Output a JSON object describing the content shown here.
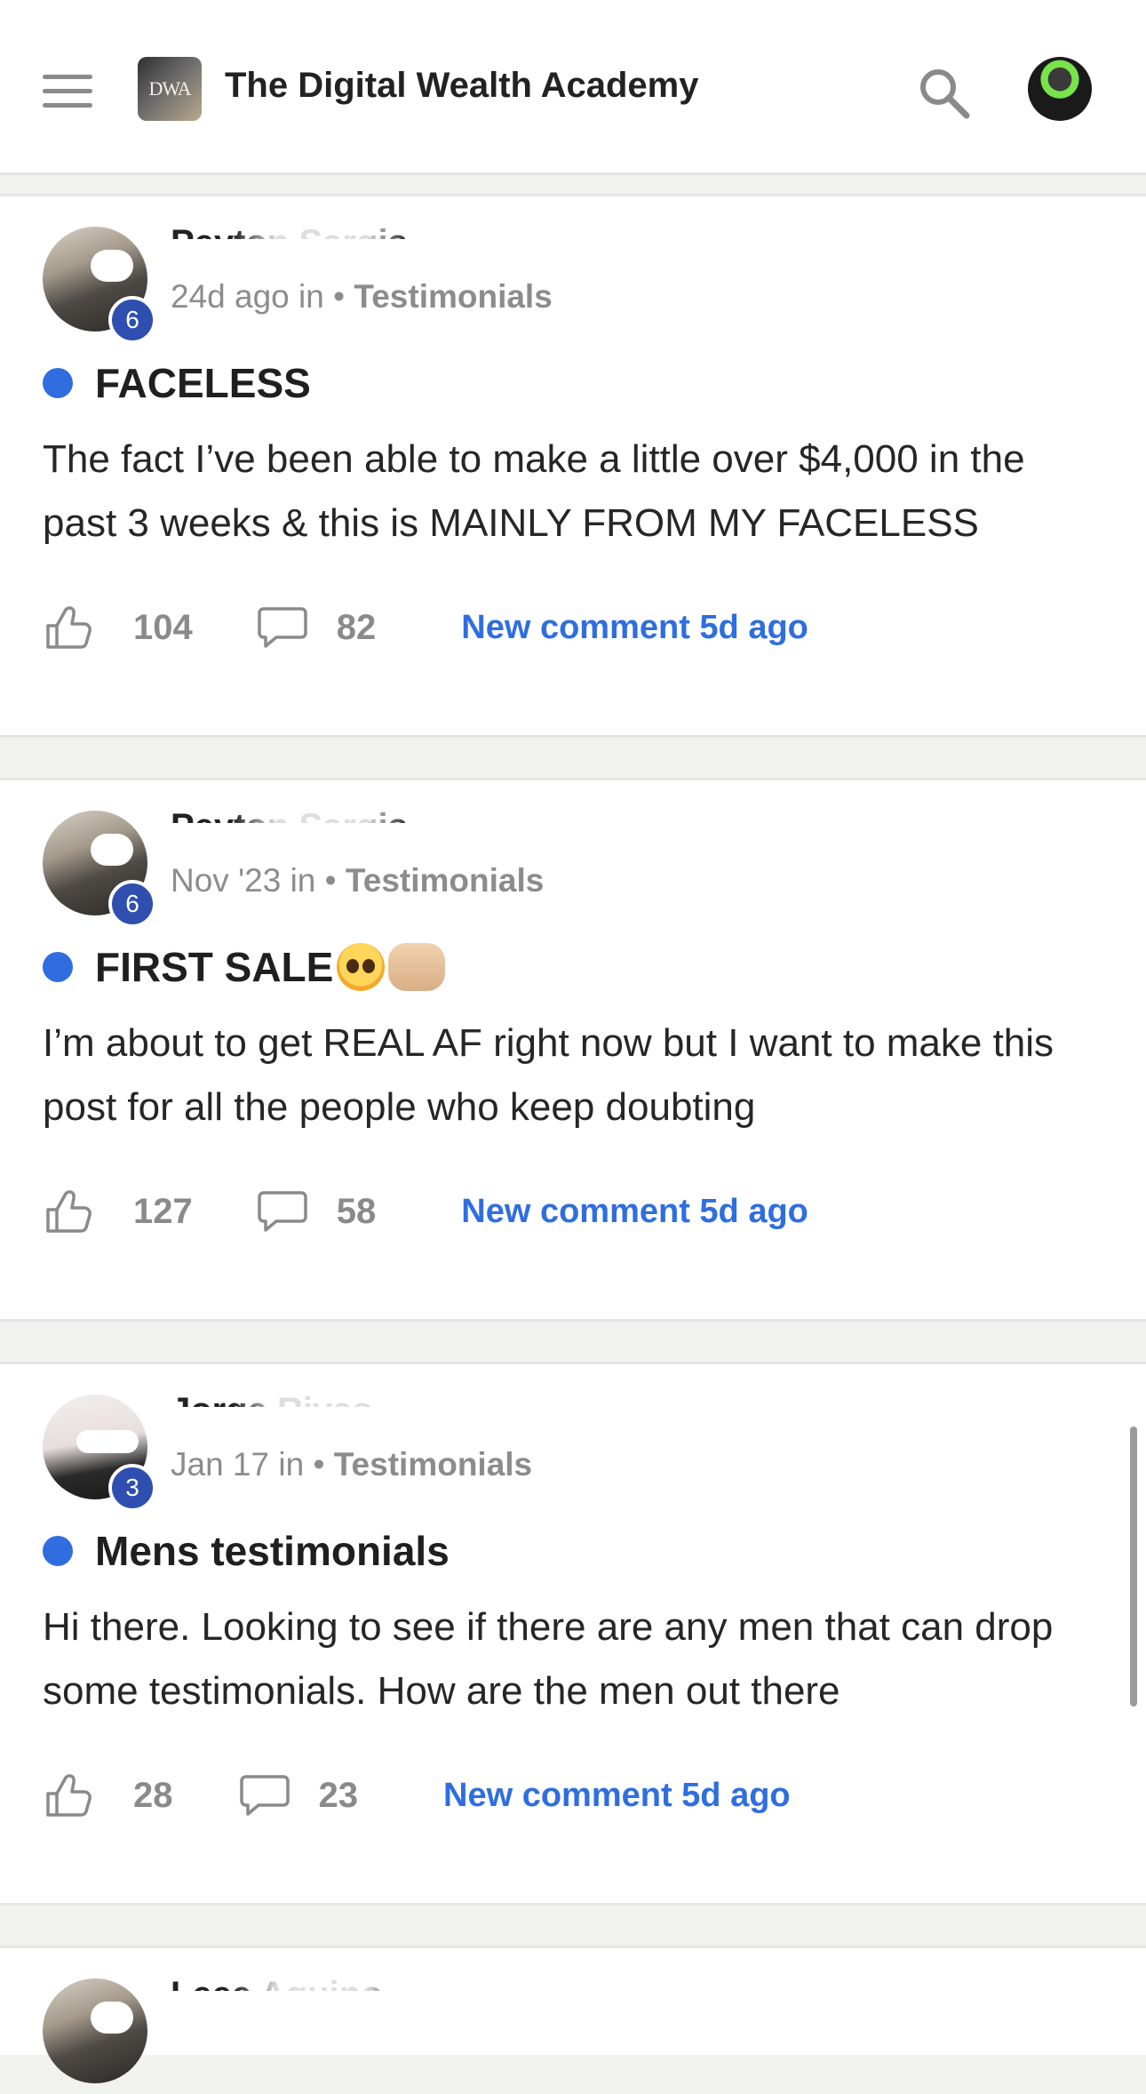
{
  "header": {
    "logo_text": "DWA",
    "title": "The Digital Wealth Academy"
  },
  "posts": [
    {
      "author": "Peyton Sargis",
      "level": "6",
      "time": "24d ago in",
      "sep": "•",
      "category": "Testimonials",
      "title": "FACELESS",
      "body": "The fact I’ve been able to make a little over $4,000 in the past 3 weeks & this is MAINLY FROM MY FACELESS",
      "likes": "104",
      "comments": "82",
      "new_comment": "New comment 5d ago"
    },
    {
      "author": "Peyton Sargis",
      "level": "6",
      "time": "Nov '23 in",
      "sep": "•",
      "category": "Testimonials",
      "title": "FIRST SALE",
      "title_emojis": [
        "pleading-face-emoji",
        "raising-hands-emoji"
      ],
      "body": "I’m about to get REAL AF right now but I want to make this post for all the people who keep doubting",
      "likes": "127",
      "comments": "58",
      "new_comment": "New comment 5d ago"
    },
    {
      "author": "Jorge Rivas",
      "level": "3",
      "time": "Jan 17 in",
      "sep": "•",
      "category": "Testimonials",
      "title": "Mens testimonials",
      "body": "Hi there. Looking to see if there are any men that can drop some testimonials. How are the men out there",
      "likes": "28",
      "comments": "23",
      "new_comment": "New comment 5d ago"
    },
    {
      "author": "Leee Aguino"
    }
  ],
  "colors": {
    "accent": "#2f6de1",
    "badge": "#2f4fb0",
    "muted": "#8a8a8a"
  }
}
